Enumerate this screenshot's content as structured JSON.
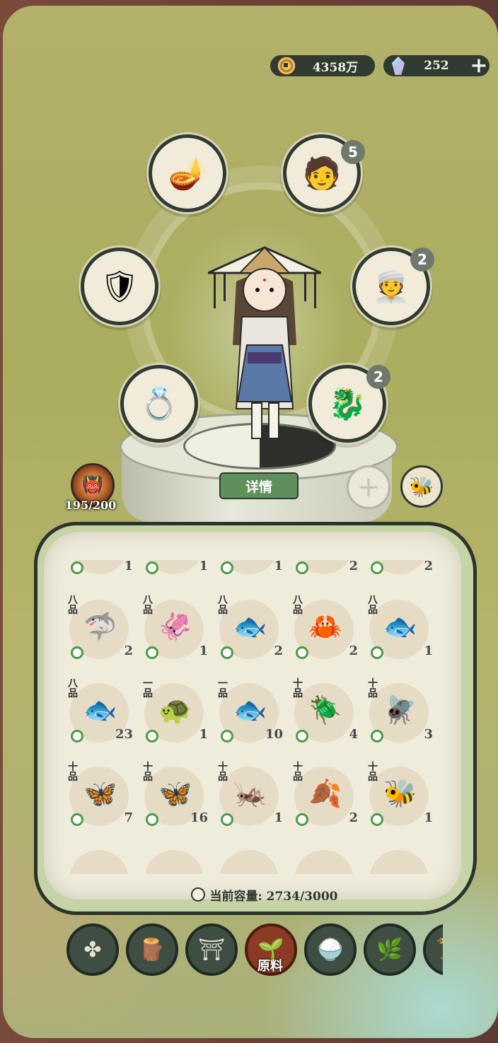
{
  "currency": {
    "coins": "4358万",
    "gems": "252",
    "add_symbol": "+"
  },
  "equipment_slots": [
    {
      "name": "lotus-lamp",
      "icon": "🪔",
      "badge": ""
    },
    {
      "name": "companion-1",
      "icon": "🧑",
      "badge": "5"
    },
    {
      "name": "armor",
      "icon": "🛡",
      "badge": ""
    },
    {
      "name": "companion-2",
      "icon": "👳",
      "badge": "2"
    },
    {
      "name": "ring",
      "icon": "💍",
      "badge": ""
    },
    {
      "name": "beast-spirit",
      "icon": "🐉",
      "badge": "2"
    }
  ],
  "detail_button": "详情",
  "add_slot_symbol": "+",
  "boss": {
    "icon": "👹",
    "count": "195/200"
  },
  "inventory": {
    "rows": [
      [
        {
          "tier": "",
          "icon": "🐟",
          "count": "1"
        },
        {
          "tier": "",
          "icon": "🐟",
          "count": "1"
        },
        {
          "tier": "",
          "icon": "🦞",
          "count": "1"
        },
        {
          "tier": "",
          "icon": "🐟",
          "count": "2"
        },
        {
          "tier": "",
          "icon": "🐠",
          "count": "2"
        }
      ],
      [
        {
          "tier": "八品",
          "icon": "🦈",
          "count": "2"
        },
        {
          "tier": "八品",
          "icon": "🦑",
          "count": "1"
        },
        {
          "tier": "八品",
          "icon": "🐟",
          "count": "2"
        },
        {
          "tier": "八品",
          "icon": "🦀",
          "count": "2"
        },
        {
          "tier": "八品",
          "icon": "🐟",
          "count": "1"
        }
      ],
      [
        {
          "tier": "八品",
          "icon": "🐟",
          "count": "23"
        },
        {
          "tier": "一品",
          "icon": "🐢",
          "count": "1"
        },
        {
          "tier": "一品",
          "icon": "🐟",
          "count": "10"
        },
        {
          "tier": "十品",
          "icon": "🪲",
          "count": "4"
        },
        {
          "tier": "十品",
          "icon": "🪰",
          "count": "3"
        }
      ],
      [
        {
          "tier": "十品",
          "icon": "🦋",
          "count": "7"
        },
        {
          "tier": "十品",
          "icon": "🦋",
          "count": "16"
        },
        {
          "tier": "十品",
          "icon": "🦗",
          "count": "1"
        },
        {
          "tier": "十品",
          "icon": "🍂",
          "count": "2"
        },
        {
          "tier": "十品",
          "icon": "🐝",
          "count": "1"
        }
      ]
    ],
    "capacity": "当前容量: 2734/3000"
  },
  "tabs": [
    {
      "name": "all",
      "icon": "✤"
    },
    {
      "name": "wood",
      "icon": "🪵"
    },
    {
      "name": "building",
      "icon": "⛩"
    },
    {
      "name": "materials",
      "icon": "🌱",
      "label": "原料"
    },
    {
      "name": "food",
      "icon": "🍚"
    },
    {
      "name": "herb",
      "icon": "🌿"
    },
    {
      "name": "scroll",
      "icon": "📜"
    }
  ]
}
